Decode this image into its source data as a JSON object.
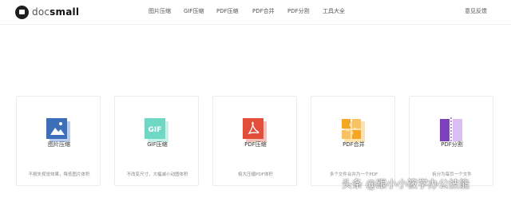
{
  "header": {
    "logo_prefix": "doc",
    "logo_suffix": "small",
    "nav": [
      "图片压缩",
      "GIF压缩",
      "PDF压缩",
      "PDF合并",
      "PDF分割",
      "工具大全"
    ],
    "feedback": "意见反馈"
  },
  "cards": [
    {
      "title": "图片压缩",
      "desc": "不损失视觉效果，降低图片体积",
      "icon": "image-compress-icon",
      "color": "#3d6fb8"
    },
    {
      "title": "GIF压缩",
      "desc": "不改变尺寸，大幅减小动图体积",
      "icon": "gif-compress-icon",
      "color": "#6fd8c4"
    },
    {
      "title": "PDF压缩",
      "desc": "极大压缩PDF体积",
      "icon": "pdf-compress-icon",
      "color": "#e24e3a"
    },
    {
      "title": "PDF合并",
      "desc": "多个文件合并为一个PDF",
      "icon": "pdf-merge-icon",
      "color": "#f5a623"
    },
    {
      "title": "PDF分割",
      "desc": "拆分为每页一个文件",
      "icon": "pdf-split-icon",
      "color": "#7b3fbf"
    }
  ],
  "watermark": "头条 @跟小小筱学办公技能",
  "colors": {
    "accent_blue": "#3d6fb8",
    "accent_teal": "#6fd8c4",
    "accent_red": "#e24e3a",
    "accent_orange": "#f5a623",
    "accent_purple": "#7b3fbf"
  }
}
